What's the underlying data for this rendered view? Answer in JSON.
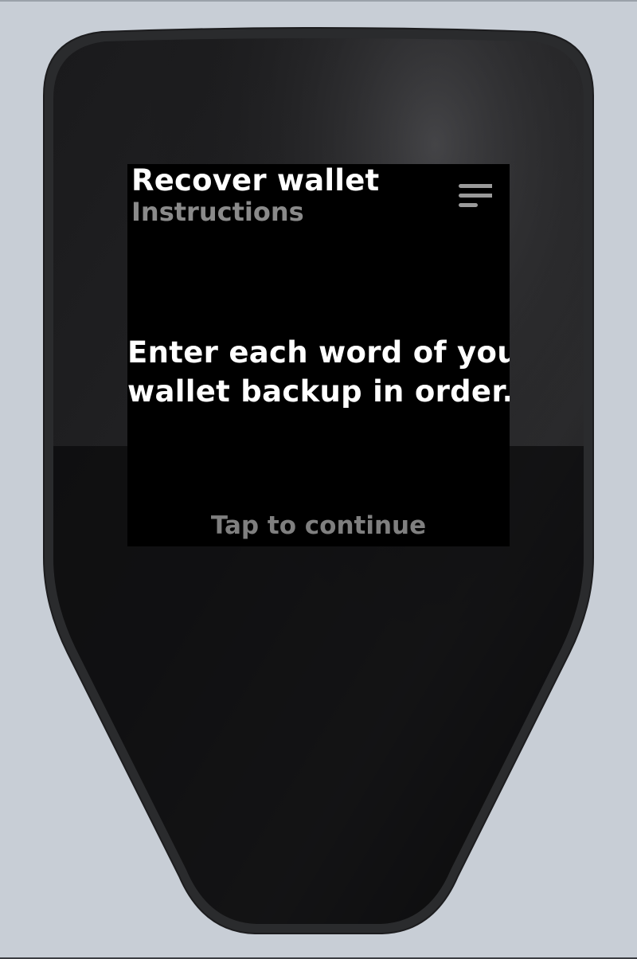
{
  "screen": {
    "title": "Recover wallet",
    "subtitle": "Instructions",
    "message_line1": "Enter each word of your",
    "message_line2": "wallet backup in order.",
    "footer_label": "Tap to continue",
    "menu_icon": "menu-icon"
  },
  "colors": {
    "background": "#c8ced6",
    "device_body": "#0b0b0c",
    "screen": "#000000",
    "title": "#ffffff",
    "subtitle": "#8a8a8a",
    "footer": "#7f7f7f"
  }
}
